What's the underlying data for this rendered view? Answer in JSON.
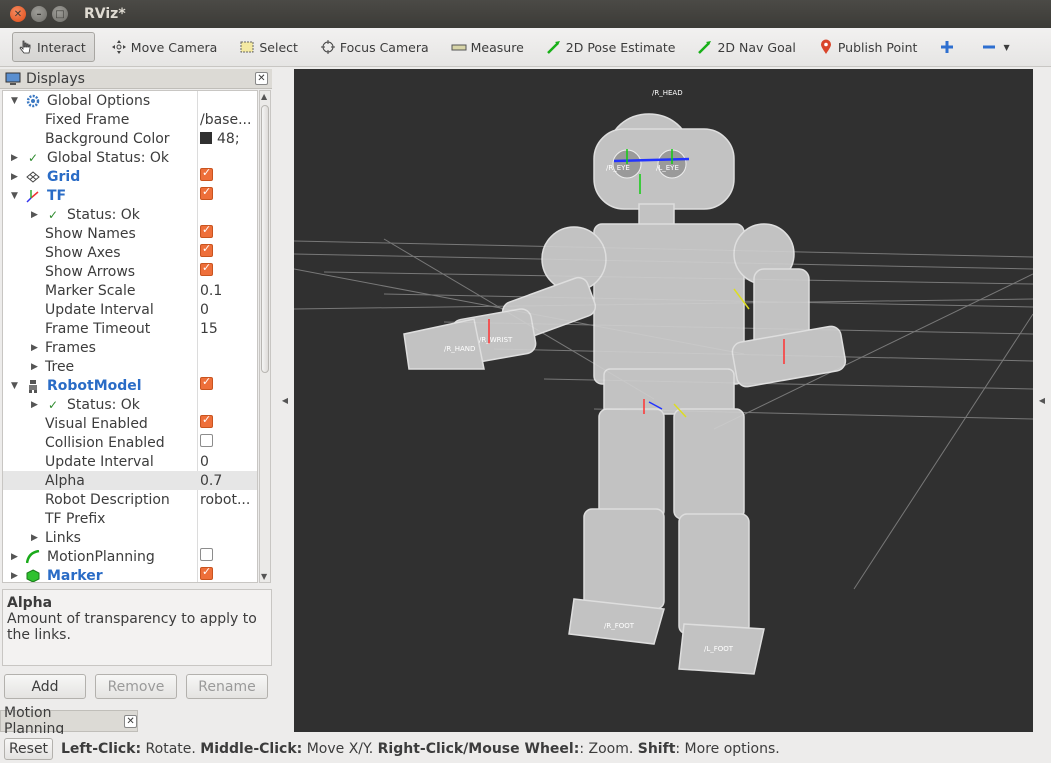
{
  "window": {
    "title": "RViz*"
  },
  "toolbar": [
    {
      "label": "Interact",
      "icon": "hand-pointer-icon",
      "active": true
    },
    {
      "label": "Move Camera",
      "icon": "move-camera-icon"
    },
    {
      "label": "Select",
      "icon": "select-box-icon"
    },
    {
      "label": "Focus Camera",
      "icon": "focus-camera-icon"
    },
    {
      "label": "Measure",
      "icon": "ruler-icon"
    },
    {
      "label": "2D Pose Estimate",
      "icon": "green-arrow-icon"
    },
    {
      "label": "2D Nav Goal",
      "icon": "green-arrow-icon"
    },
    {
      "label": "Publish Point",
      "icon": "map-pin-icon"
    }
  ],
  "displays": {
    "title": "Displays",
    "rows": [
      {
        "label": "Global Options",
        "level": 0,
        "arrow": "▼",
        "icon": "gear-icon"
      },
      {
        "label": "Fixed Frame",
        "level": 1,
        "value": "/base..."
      },
      {
        "label": "Background Color",
        "level": 1,
        "value": "48;",
        "swatch": "#303030"
      },
      {
        "label": "Global Status: Ok",
        "level": 0,
        "arrow": "▶",
        "icon": "check-icon"
      },
      {
        "label": "Grid",
        "level": 0,
        "arrow": "▶",
        "icon": "grid-icon",
        "blue": true,
        "check": true
      },
      {
        "label": "TF",
        "level": 0,
        "arrow": "▼",
        "icon": "axes-icon",
        "blue": true,
        "check": true
      },
      {
        "label": "Status: Ok",
        "level": 1,
        "arrow": "▶",
        "icon": "check-icon"
      },
      {
        "label": "Show Names",
        "level": 1,
        "check": true
      },
      {
        "label": "Show Axes",
        "level": 1,
        "check": true
      },
      {
        "label": "Show Arrows",
        "level": 1,
        "check": true
      },
      {
        "label": "Marker Scale",
        "level": 1,
        "value": "0.1"
      },
      {
        "label": "Update Interval",
        "level": 1,
        "value": "0"
      },
      {
        "label": "Frame Timeout",
        "level": 1,
        "value": "15"
      },
      {
        "label": "Frames",
        "level": 1,
        "arrow": "▶"
      },
      {
        "label": "Tree",
        "level": 1,
        "arrow": "▶"
      },
      {
        "label": "RobotModel",
        "level": 0,
        "arrow": "▼",
        "icon": "robot-icon",
        "blue": true,
        "check": true
      },
      {
        "label": "Status: Ok",
        "level": 1,
        "arrow": "▶",
        "icon": "check-icon"
      },
      {
        "label": "Visual Enabled",
        "level": 1,
        "check": true
      },
      {
        "label": "Collision Enabled",
        "level": 1,
        "check": false
      },
      {
        "label": "Update Interval",
        "level": 1,
        "value": "0"
      },
      {
        "label": "Alpha",
        "level": 1,
        "value": "0.7",
        "selected": true
      },
      {
        "label": "Robot Description",
        "level": 1,
        "value": "robot..."
      },
      {
        "label": "TF Prefix",
        "level": 1
      },
      {
        "label": "Links",
        "level": 1,
        "arrow": "▶"
      },
      {
        "label": "MotionPlanning",
        "level": 0,
        "arrow": "▶",
        "icon": "motion-planning-icon",
        "check": false
      },
      {
        "label": "Marker",
        "level": 0,
        "arrow": "▶",
        "icon": "marker-cube-icon",
        "blue": true,
        "check": true
      }
    ]
  },
  "description": {
    "heading": "Alpha",
    "text": "Amount of transparency to apply to the links."
  },
  "buttons": {
    "add": "Add",
    "remove": "Remove",
    "rename": "Rename"
  },
  "motion_planning_tab": "Motion Planning",
  "frame_labels": {
    "head": "/R_HEAD",
    "r_eye": "/R_EYE",
    "l_eye": "/L_EYE",
    "r_hand": "/R_HAND",
    "r_wrist": "/R_WRIST",
    "r_foot": "/R_FOOT",
    "l_foot": "/L_FOOT"
  },
  "status": {
    "reset": "Reset",
    "b1": "Left-Click:",
    "t1": " Rotate. ",
    "b2": "Middle-Click:",
    "t2": " Move X/Y. ",
    "b3": "Right-Click/Mouse Wheel:",
    "t3": ": Zoom. ",
    "b4": "Shift",
    "t4": ": More options."
  }
}
